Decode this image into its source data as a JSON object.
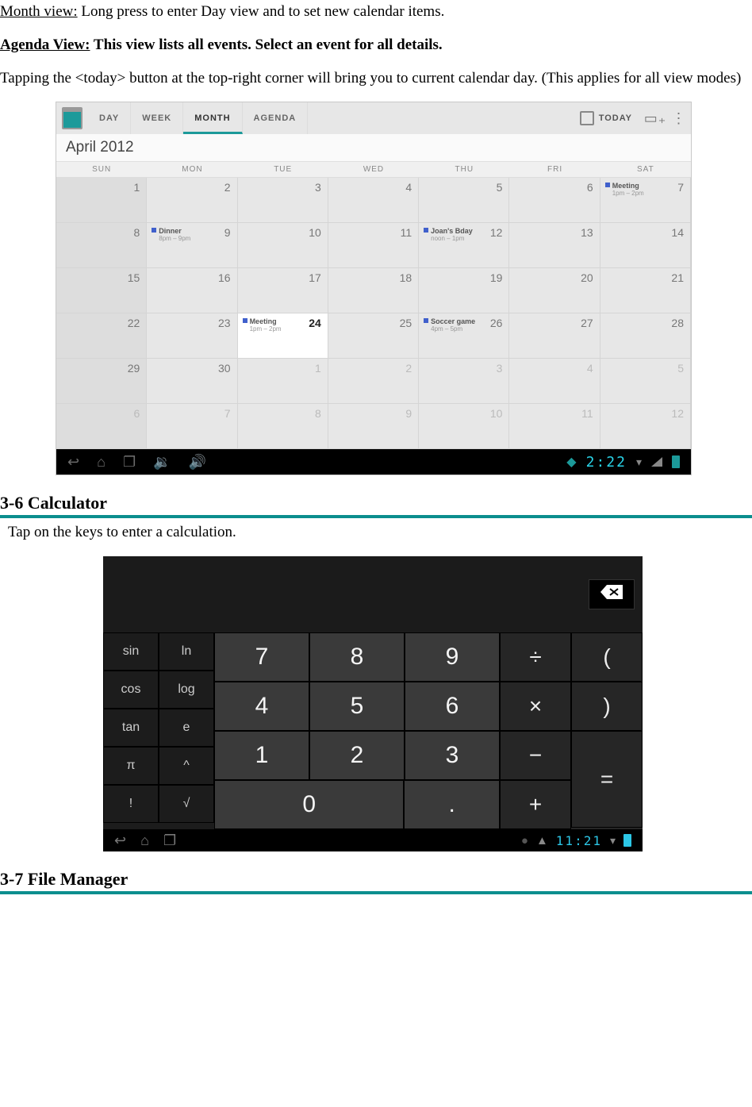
{
  "text": {
    "month_label": "Month view:",
    "month_desc": " Long press to enter Day view and to set new calendar items.",
    "agenda_label": "Agenda View:",
    "agenda_desc": " This view lists all events. Select an event for all details.",
    "today_para": "Tapping the <today> button at the top-right corner will bring you to current calendar day.    (This applies for all view modes)",
    "sec_calc": "3-6 Calculator",
    "calc_desc": "Tap on the keys to enter a calculation.",
    "sec_file": "3-7 File Manager"
  },
  "calendar": {
    "tabs": {
      "day": "DAY",
      "week": "WEEK",
      "month": "MONTH",
      "agenda": "AGENDA"
    },
    "today_label": "TODAY",
    "month_title": "April 2012",
    "dow": [
      "SUN",
      "MON",
      "TUE",
      "WED",
      "THU",
      "FRI",
      "SAT"
    ],
    "weeks": [
      [
        {
          "n": "1",
          "sun": true
        },
        {
          "n": "2"
        },
        {
          "n": "3"
        },
        {
          "n": "4"
        },
        {
          "n": "5"
        },
        {
          "n": "6"
        },
        {
          "n": "7",
          "ev": {
            "t": "Meeting",
            "tm": "1pm – 2pm"
          }
        }
      ],
      [
        {
          "n": "8",
          "sun": true
        },
        {
          "n": "9",
          "ev": {
            "t": "Dinner",
            "tm": "8pm – 9pm"
          }
        },
        {
          "n": "10"
        },
        {
          "n": "11"
        },
        {
          "n": "12",
          "ev": {
            "t": "Joan's Bday",
            "tm": "noon – 1pm"
          }
        },
        {
          "n": "13"
        },
        {
          "n": "14"
        }
      ],
      [
        {
          "n": "15",
          "sun": true
        },
        {
          "n": "16"
        },
        {
          "n": "17"
        },
        {
          "n": "18"
        },
        {
          "n": "19"
        },
        {
          "n": "20"
        },
        {
          "n": "21"
        }
      ],
      [
        {
          "n": "22",
          "sun": true
        },
        {
          "n": "23"
        },
        {
          "n": "24",
          "today": true,
          "ev": {
            "t": "Meeting",
            "tm": "1pm – 2pm"
          }
        },
        {
          "n": "25"
        },
        {
          "n": "26",
          "ev": {
            "t": "Soccer game",
            "tm": "4pm – 5pm"
          }
        },
        {
          "n": "27"
        },
        {
          "n": "28"
        }
      ],
      [
        {
          "n": "29",
          "sun": true
        },
        {
          "n": "30"
        },
        {
          "n": "1",
          "out": true
        },
        {
          "n": "2",
          "out": true
        },
        {
          "n": "3",
          "out": true
        },
        {
          "n": "4",
          "out": true
        },
        {
          "n": "5",
          "out": true
        }
      ],
      [
        {
          "n": "6",
          "out": true,
          "sun": true
        },
        {
          "n": "7",
          "out": true
        },
        {
          "n": "8",
          "out": true
        },
        {
          "n": "9",
          "out": true
        },
        {
          "n": "10",
          "out": true
        },
        {
          "n": "11",
          "out": true
        },
        {
          "n": "12",
          "out": true
        }
      ]
    ],
    "status_time": "2:22"
  },
  "calculator": {
    "sci": [
      [
        "sin",
        "ln"
      ],
      [
        "cos",
        "log"
      ],
      [
        "tan",
        "e"
      ],
      [
        "π",
        "^"
      ],
      [
        "!",
        "√"
      ]
    ],
    "num": [
      [
        "7",
        "8",
        "9"
      ],
      [
        "4",
        "5",
        "6"
      ],
      [
        "1",
        "2",
        "3"
      ],
      [
        "0",
        "."
      ]
    ],
    "ops_top": [
      [
        "÷",
        "("
      ],
      [
        "×",
        ")"
      ],
      [
        "−"
      ],
      [
        "+"
      ]
    ],
    "eq": "=",
    "status_time": "11:21"
  }
}
